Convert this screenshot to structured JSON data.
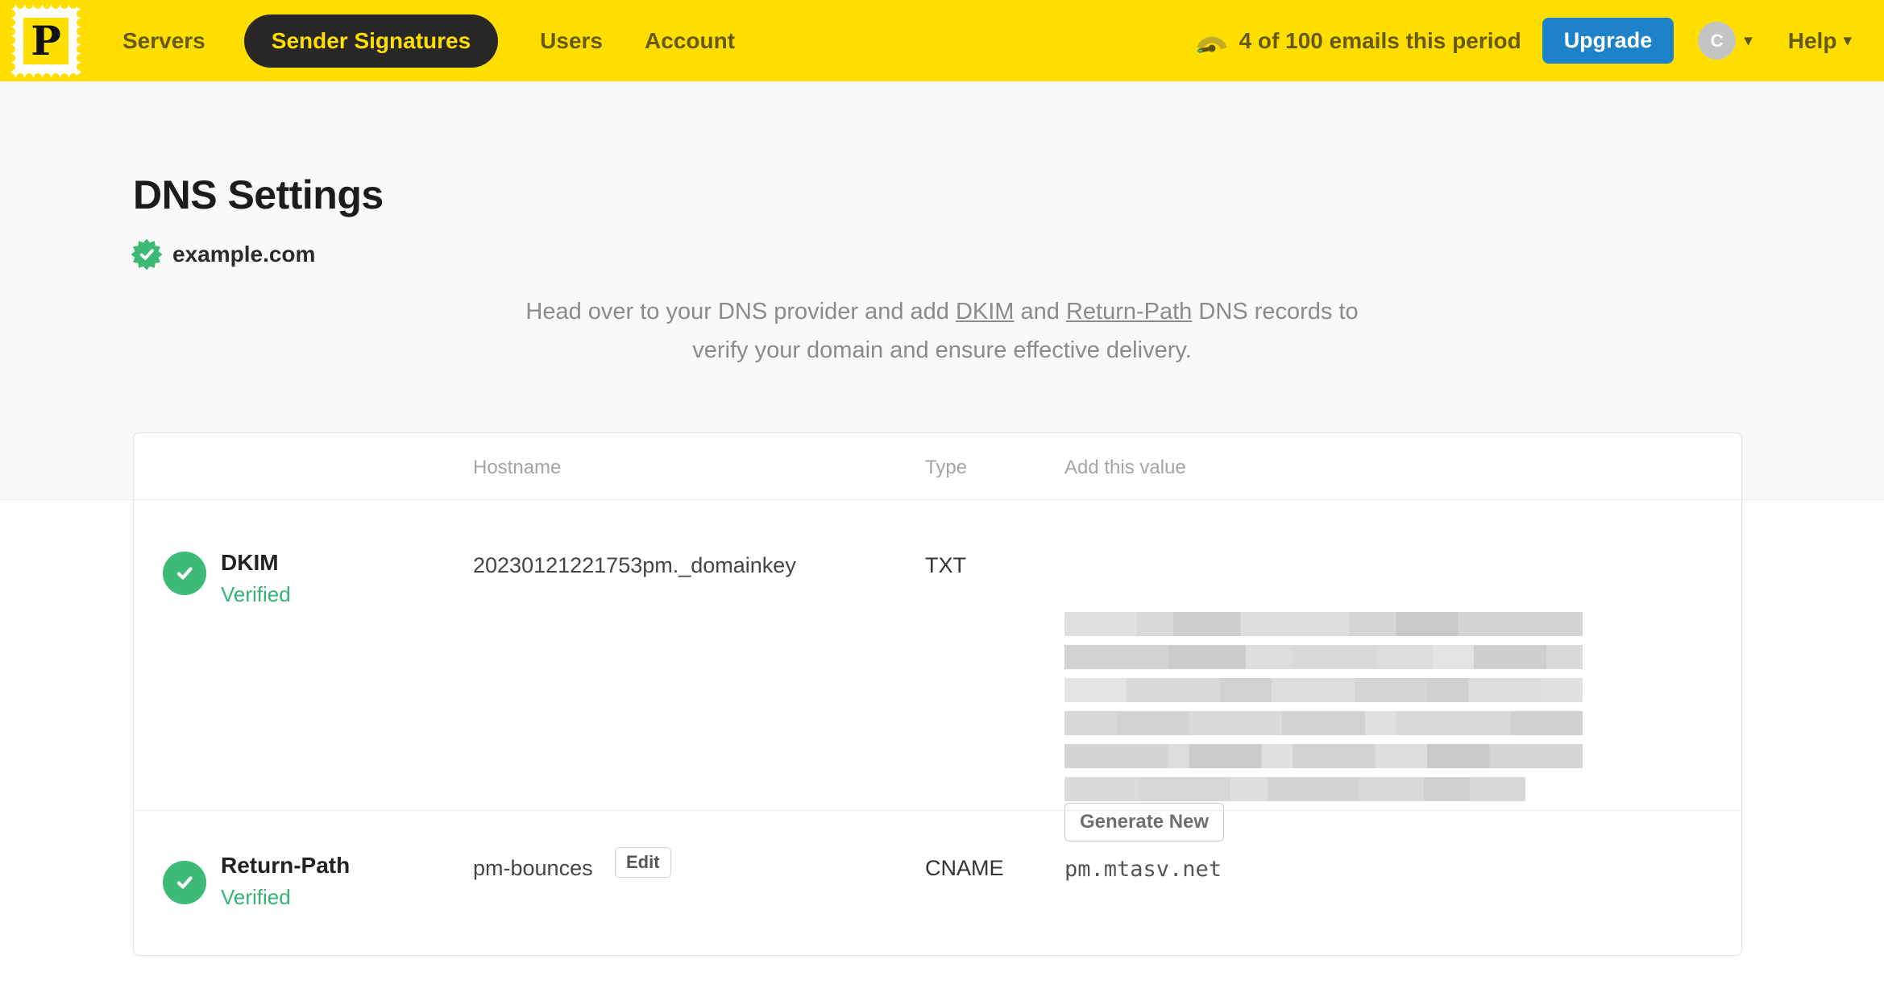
{
  "nav": {
    "logo_letter": "P",
    "items": [
      {
        "label": "Servers",
        "active": false
      },
      {
        "label": "Sender Signatures",
        "active": true
      },
      {
        "label": "Users",
        "active": false
      },
      {
        "label": "Account",
        "active": false
      }
    ],
    "usage_text": "4 of 100 emails this period",
    "upgrade_label": "Upgrade",
    "avatar_initial": "C",
    "help_label": "Help"
  },
  "page": {
    "title": "DNS Settings",
    "domain": "example.com",
    "description": {
      "part1": "Head over to your DNS provider and add ",
      "link1": "DKIM",
      "part2": " and ",
      "link2": "Return-Path",
      "part3": " DNS records to",
      "line2": "verify your domain and ensure effective delivery."
    }
  },
  "table": {
    "headers": {
      "hostname": "Hostname",
      "type": "Type",
      "value": "Add this value"
    },
    "rows": [
      {
        "name": "DKIM",
        "status": "Verified",
        "hostname": "20230121221753pm._domainkey",
        "type": "TXT",
        "value_redacted": true,
        "action_label": "Generate New"
      },
      {
        "name": "Return-Path",
        "status": "Verified",
        "hostname": "pm-bounces",
        "edit_label": "Edit",
        "type": "CNAME",
        "value": "pm.mtasv.net"
      }
    ]
  },
  "icons": {
    "logo": "postmark-stamp-icon",
    "usage": "gauge-icon",
    "domain": "verified-seal-icon",
    "row_status": "check-circle-icon",
    "dropdown": "caret-down-icon"
  },
  "colors": {
    "navbar_bg": "#ffde00",
    "nav_text": "#665910",
    "active_pill_bg": "#282725",
    "upgrade_blue": "#1d82c7",
    "verified_green": "#3cba76",
    "hero_bg": "#f9f9f9",
    "muted_text": "#8b8b8b"
  }
}
